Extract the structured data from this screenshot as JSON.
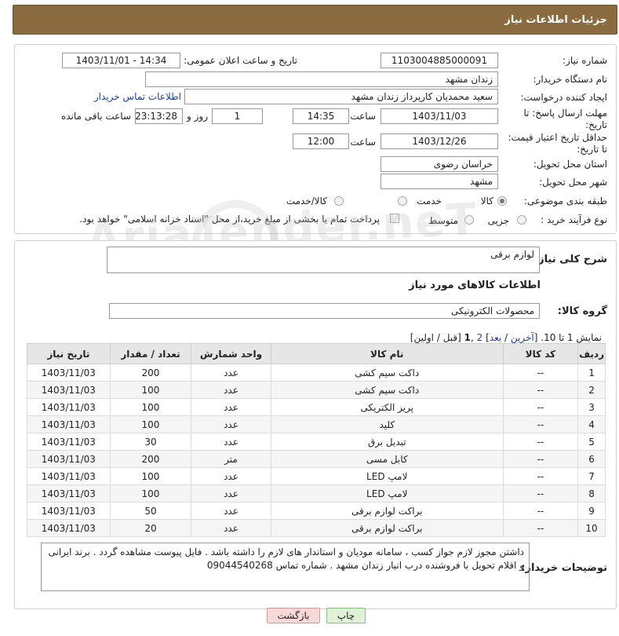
{
  "header": {
    "title": "جزئیات اطلاعات نیاز"
  },
  "need_info": {
    "need_number_label": "شماره نیاز:",
    "need_number": "1103004885000091",
    "announce_label": "تاریخ و ساعت اعلان عمومی:",
    "announce_value": "1403/11/01 - 14:34",
    "buyer_org_label": "نام دستگاه خریدار:",
    "buyer_org": "زندان مشهد",
    "creator_label": "ایجاد کننده درخواست:",
    "creator": "سعید محمدیان کارپرداز زندان مشهد",
    "buyer_contact_link": "اطلاعات تماس خریدار",
    "deadline_label": "مهلت ارسال پاسخ: تا تاریخ:",
    "deadline_date": "1403/11/03",
    "time_word": "ساعت",
    "deadline_time": "14:35",
    "days_value": "1",
    "days_word": "روز و",
    "remaining_time": "23:13:28",
    "remaining_word": "ساعت باقی مانده",
    "validity_label": "حداقل تاریخ اعتبار قیمت: تا تاریخ:",
    "validity_date": "1403/12/26",
    "validity_time": "12:00",
    "province_label": "استان محل تحویل:",
    "province": "خراسان رضوی",
    "city_label": "شهر محل تحویل:",
    "city": "مشهد",
    "category_label": "طبقه بندی موضوعی:",
    "category_options": [
      "کالا",
      "خدمت",
      "کالا/خدمت"
    ],
    "category_selected": "کالا",
    "process_label": "نوع فرآیند خرید :",
    "process_options": [
      "جزیی",
      "متوسط"
    ],
    "payment_note": "پرداخت تمام یا بخشی از مبلغ خرید،از محل \"اسناد خزانه اسلامی\" خواهد بود."
  },
  "goods": {
    "summary_label": "شرح کلی نیاز:",
    "summary_value": "لوازم برقی",
    "section_title": "اطلاعات کالاهای مورد نیاز",
    "group_label": "گروه کالا:",
    "group_value": "محصولات الکترونیکی",
    "paging": {
      "prefix": "نمایش 1 تا 10. [",
      "last": "آخرین",
      "sep1": " / ",
      "next": "بعد",
      "sep2": "] ",
      "page2": "2",
      "sep3": " ,",
      "page1": "1",
      "suffix": " [قبل / اولین]"
    },
    "columns": [
      "ردیف",
      "کد کالا",
      "نام کالا",
      "واحد شمارش",
      "تعداد / مقدار",
      "تاریخ نیاز"
    ],
    "rows": [
      [
        "1",
        "--",
        "داکت سیم کشی",
        "عدد",
        "200",
        "1403/11/03"
      ],
      [
        "2",
        "--",
        "داکت سیم کشی",
        "عدد",
        "100",
        "1403/11/03"
      ],
      [
        "3",
        "--",
        "پریز الکتریکی",
        "عدد",
        "100",
        "1403/11/03"
      ],
      [
        "4",
        "--",
        "کلید",
        "عدد",
        "100",
        "1403/11/03"
      ],
      [
        "5",
        "--",
        "تبدیل برق",
        "عدد",
        "30",
        "1403/11/03"
      ],
      [
        "6",
        "--",
        "کابل مسی",
        "متر",
        "200",
        "1403/11/03"
      ],
      [
        "7",
        "--",
        "لامپ LED",
        "عدد",
        "100",
        "1403/11/03"
      ],
      [
        "8",
        "--",
        "لامپ LED",
        "عدد",
        "100",
        "1403/11/03"
      ],
      [
        "9",
        "--",
        "براکت لوازم برقی",
        "عدد",
        "50",
        "1403/11/03"
      ],
      [
        "10",
        "--",
        "براکت لوازم برقی",
        "عدد",
        "20",
        "1403/11/03"
      ]
    ],
    "buyer_notes_label": "توضیحات خریدار:",
    "buyer_notes": "داشتن مجوز لازم جواز کسب ، سامانه مودیان و استاندار های لازم را داشته باشد . فایل پیوست مشاهده گردد . برند ایرانی و اقلام تحویل با فروشنده درب انبار زندان مشهد . شماره تماس 09044540268"
  },
  "buttons": {
    "print": "چاپ",
    "back": "بازگشت"
  },
  "watermark": "AriaTender.neT",
  "colors": {
    "header_bg": "#8a6b3f",
    "link": "#1a3fa0",
    "back_btn_bg": "#f7d9d9",
    "print_btn_bg": "#dff2d8"
  }
}
